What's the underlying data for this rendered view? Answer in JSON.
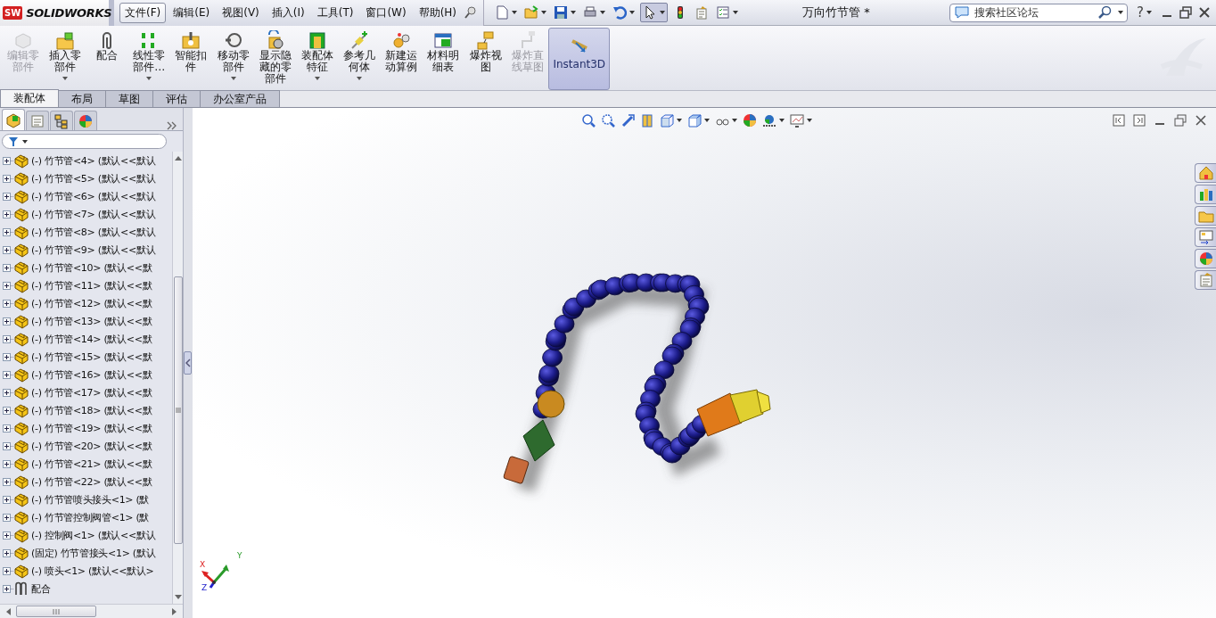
{
  "logo": {
    "badge": "SW",
    "text": "SOLIDWORKS"
  },
  "menu": [
    {
      "label": "文件(F)",
      "selected": true
    },
    {
      "label": "编辑(E)",
      "selected": false
    },
    {
      "label": "视图(V)",
      "selected": false
    },
    {
      "label": "插入(I)",
      "selected": false
    },
    {
      "label": "工具(T)",
      "selected": false
    },
    {
      "label": "窗口(W)",
      "selected": false
    },
    {
      "label": "帮助(H)",
      "selected": false
    }
  ],
  "document_title": "万向竹节管 *",
  "search": {
    "placeholder": "搜索社区论坛"
  },
  "help_label": "?",
  "ribbon": [
    {
      "label": "编辑零部件",
      "disabled": true,
      "dropdown": false,
      "selected": false
    },
    {
      "label": "插入零部件",
      "disabled": false,
      "dropdown": true,
      "selected": false
    },
    {
      "label": "配合",
      "disabled": false,
      "dropdown": false,
      "selected": false
    },
    {
      "label": "线性零部件…",
      "disabled": false,
      "dropdown": true,
      "selected": false
    },
    {
      "label": "智能扣件",
      "disabled": false,
      "dropdown": false,
      "selected": false
    },
    {
      "label": "移动零部件",
      "disabled": false,
      "dropdown": true,
      "selected": false
    },
    {
      "label": "显示隐藏的零部件",
      "disabled": false,
      "dropdown": false,
      "selected": false
    },
    {
      "label": "装配体特征",
      "disabled": false,
      "dropdown": true,
      "selected": false
    },
    {
      "label": "参考几何体",
      "disabled": false,
      "dropdown": true,
      "selected": false
    },
    {
      "label": "新建运动算例",
      "disabled": false,
      "dropdown": false,
      "selected": false
    },
    {
      "label": "材料明细表",
      "disabled": false,
      "dropdown": false,
      "selected": false
    },
    {
      "label": "爆炸视图",
      "disabled": false,
      "dropdown": false,
      "selected": false
    },
    {
      "label": "爆炸直线草图",
      "disabled": true,
      "dropdown": false,
      "selected": false
    },
    {
      "label": "Instant3D",
      "disabled": false,
      "dropdown": false,
      "selected": true
    }
  ],
  "tabs": [
    {
      "label": "装配体",
      "selected": true
    },
    {
      "label": "布局",
      "selected": false
    },
    {
      "label": "草图",
      "selected": false
    },
    {
      "label": "评估",
      "selected": false
    },
    {
      "label": "办公室产品",
      "selected": false
    }
  ],
  "panel_tabs": [
    {
      "selected": true
    },
    {
      "selected": false
    },
    {
      "selected": false
    },
    {
      "selected": false
    }
  ],
  "feature_tree": [
    {
      "kind": "part",
      "label": "(-) 竹节管<4> (默认<<默认"
    },
    {
      "kind": "part",
      "label": "(-) 竹节管<5> (默认<<默认"
    },
    {
      "kind": "part",
      "label": "(-) 竹节管<6> (默认<<默认"
    },
    {
      "kind": "part",
      "label": "(-) 竹节管<7> (默认<<默认"
    },
    {
      "kind": "part",
      "label": "(-) 竹节管<8> (默认<<默认"
    },
    {
      "kind": "part",
      "label": "(-) 竹节管<9> (默认<<默认"
    },
    {
      "kind": "part",
      "label": "(-) 竹节管<10> (默认<<默"
    },
    {
      "kind": "part",
      "label": "(-) 竹节管<11> (默认<<默"
    },
    {
      "kind": "part",
      "label": "(-) 竹节管<12> (默认<<默"
    },
    {
      "kind": "part",
      "label": "(-) 竹节管<13> (默认<<默"
    },
    {
      "kind": "part",
      "label": "(-) 竹节管<14> (默认<<默"
    },
    {
      "kind": "part",
      "label": "(-) 竹节管<15> (默认<<默"
    },
    {
      "kind": "part",
      "label": "(-) 竹节管<16> (默认<<默"
    },
    {
      "kind": "part",
      "label": "(-) 竹节管<17> (默认<<默"
    },
    {
      "kind": "part",
      "label": "(-) 竹节管<18> (默认<<默"
    },
    {
      "kind": "part",
      "label": "(-) 竹节管<19> (默认<<默"
    },
    {
      "kind": "part",
      "label": "(-) 竹节管<20> (默认<<默"
    },
    {
      "kind": "part",
      "label": "(-) 竹节管<21> (默认<<默"
    },
    {
      "kind": "part",
      "label": "(-) 竹节管<22> (默认<<默"
    },
    {
      "kind": "part",
      "label": "(-) 竹节管喷头接头<1> (默"
    },
    {
      "kind": "part",
      "label": "(-) 竹节管控制阀管<1> (默"
    },
    {
      "kind": "part",
      "label": "(-) 控制阀<1> (默认<<默认"
    },
    {
      "kind": "part",
      "label": "(固定) 竹节管接头<1> (默认"
    },
    {
      "kind": "part",
      "label": "(-) 喷头<1> (默认<<默认>"
    },
    {
      "kind": "mates",
      "label": "配合"
    }
  ],
  "triad": {
    "x": "X",
    "y": "Y",
    "z": "Z"
  }
}
